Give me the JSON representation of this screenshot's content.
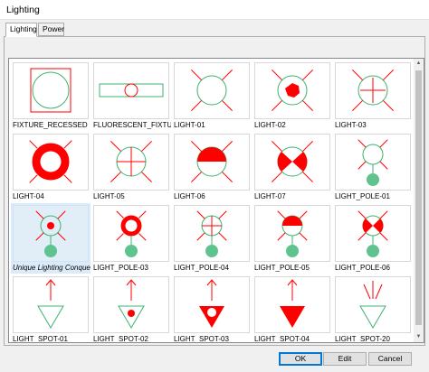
{
  "window": {
    "title": "Lighting"
  },
  "tabs": [
    {
      "label": "Lighting",
      "active": true
    },
    {
      "label": "Power",
      "active": false
    }
  ],
  "items": [
    {
      "label": "FIXTURE_RECESSED",
      "symbol": "fixture-recessed"
    },
    {
      "label": "FLUORESCENT_FIXTUR",
      "symbol": "fluorescent"
    },
    {
      "label": "LIGHT-01",
      "symbol": "light-01"
    },
    {
      "label": "LIGHT-02",
      "symbol": "light-02"
    },
    {
      "label": "LIGHT-03",
      "symbol": "light-03"
    },
    {
      "label": "LIGHT-04",
      "symbol": "light-04"
    },
    {
      "label": "LIGHT-05",
      "symbol": "light-05"
    },
    {
      "label": "LIGHT-06",
      "symbol": "light-06"
    },
    {
      "label": "LIGHT-07",
      "symbol": "light-07"
    },
    {
      "label": "LIGHT_POLE-01",
      "symbol": "pole-01"
    },
    {
      "label": "Unique Lighting Conquest",
      "symbol": "pole-02",
      "selected": true
    },
    {
      "label": "LIGHT_POLE-03",
      "symbol": "pole-03"
    },
    {
      "label": "LIGHT_POLE-04",
      "symbol": "pole-04"
    },
    {
      "label": "LIGHT_POLE-05",
      "symbol": "pole-05"
    },
    {
      "label": "LIGHT_POLE-06",
      "symbol": "pole-06"
    },
    {
      "label": "LIGHT_SPOT-01",
      "symbol": "spot-01"
    },
    {
      "label": "LIGHT_SPOT-02",
      "symbol": "spot-02"
    },
    {
      "label": "LIGHT_SPOT-03",
      "symbol": "spot-03"
    },
    {
      "label": "LIGHT_SPOT-04",
      "symbol": "spot-04"
    },
    {
      "label": "LIGHT_SPOT-20",
      "symbol": "spot-20"
    }
  ],
  "buttons": {
    "ok": "OK",
    "edit": "Edit",
    "cancel": "Cancel"
  },
  "colors": {
    "symbol_red": "#ff0000",
    "symbol_green": "#3cb371",
    "pole_green": "#5fc38f",
    "selection": "#dcebfa"
  },
  "scrollbar": {
    "up_icon": "chevron-up-icon",
    "down_icon": "chevron-down-icon"
  }
}
